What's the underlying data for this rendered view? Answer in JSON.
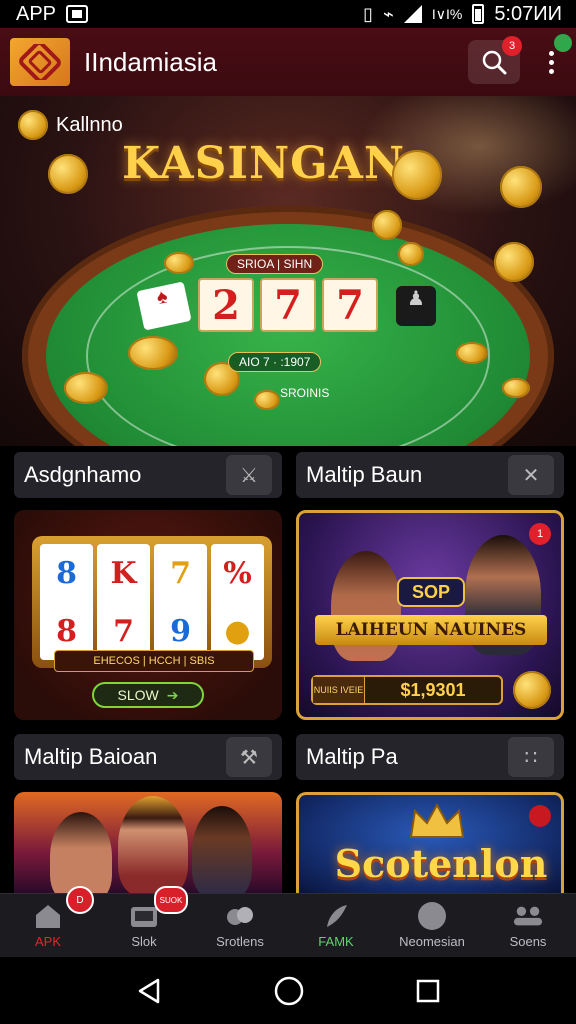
{
  "status_bar": {
    "left_text": "APP",
    "right_text": "Ι∨Ι% ■ 5:07ИИ",
    "time": "5:07ИИ",
    "battery_text": "Ι∨Ι%"
  },
  "app_bar": {
    "title": "IIndamiasia",
    "search_badge": "3"
  },
  "hero": {
    "chip_label": "Kallnno",
    "title": "KASINGAN",
    "top_label": "SRIOA | SIHN",
    "reels": [
      "2",
      "7",
      "7"
    ],
    "mid_label": "AIO 7 · :1907",
    "bottom_label": "SROINIS"
  },
  "sections": [
    {
      "title": "Asdgnhamo",
      "icon": "figure-icon"
    },
    {
      "title": "Maltip Baun",
      "icon": "close-icon"
    },
    {
      "title": "Maltip Baioan",
      "icon": "hammer-icon"
    },
    {
      "title": "Maltip Pa",
      "icon": "dots-circle-icon"
    }
  ],
  "cards": {
    "slots": {
      "reels": [
        [
          "8",
          "8"
        ],
        [
          "K",
          "7"
        ],
        [
          "7",
          "9"
        ],
        [
          "%",
          "●"
        ]
      ],
      "strip": "EHECOS | HCCH | SBIS",
      "button": "SLOW"
    },
    "people": {
      "brand": "SOP",
      "banner": "LAIHEUN NAUINES",
      "prize_tag": "NUIIS IVEIE",
      "prize_value": "$1,9301",
      "badge": "1"
    },
    "scot": {
      "title": "Scotenlon"
    }
  },
  "bottom_nav": [
    {
      "label": "APK",
      "icon": "home-icon",
      "state": "active",
      "badge": "D"
    },
    {
      "label": "Slok",
      "icon": "slot-icon",
      "state": "",
      "badge": "SUOK"
    },
    {
      "label": "Srotlens",
      "icon": "chips-icon",
      "state": "",
      "badge": ""
    },
    {
      "label": "FAMK",
      "icon": "feather-icon",
      "state": "green",
      "badge": ""
    },
    {
      "label": "Neomesian",
      "icon": "circle-icon",
      "state": "",
      "badge": ""
    },
    {
      "label": "Soens",
      "icon": "people-icon",
      "state": "",
      "badge": ""
    }
  ],
  "colors": {
    "accent_red": "#e3262e",
    "accent_gold": "#ffd04a",
    "appbar": "#4a0d14",
    "felt": "#2a9e3e"
  }
}
